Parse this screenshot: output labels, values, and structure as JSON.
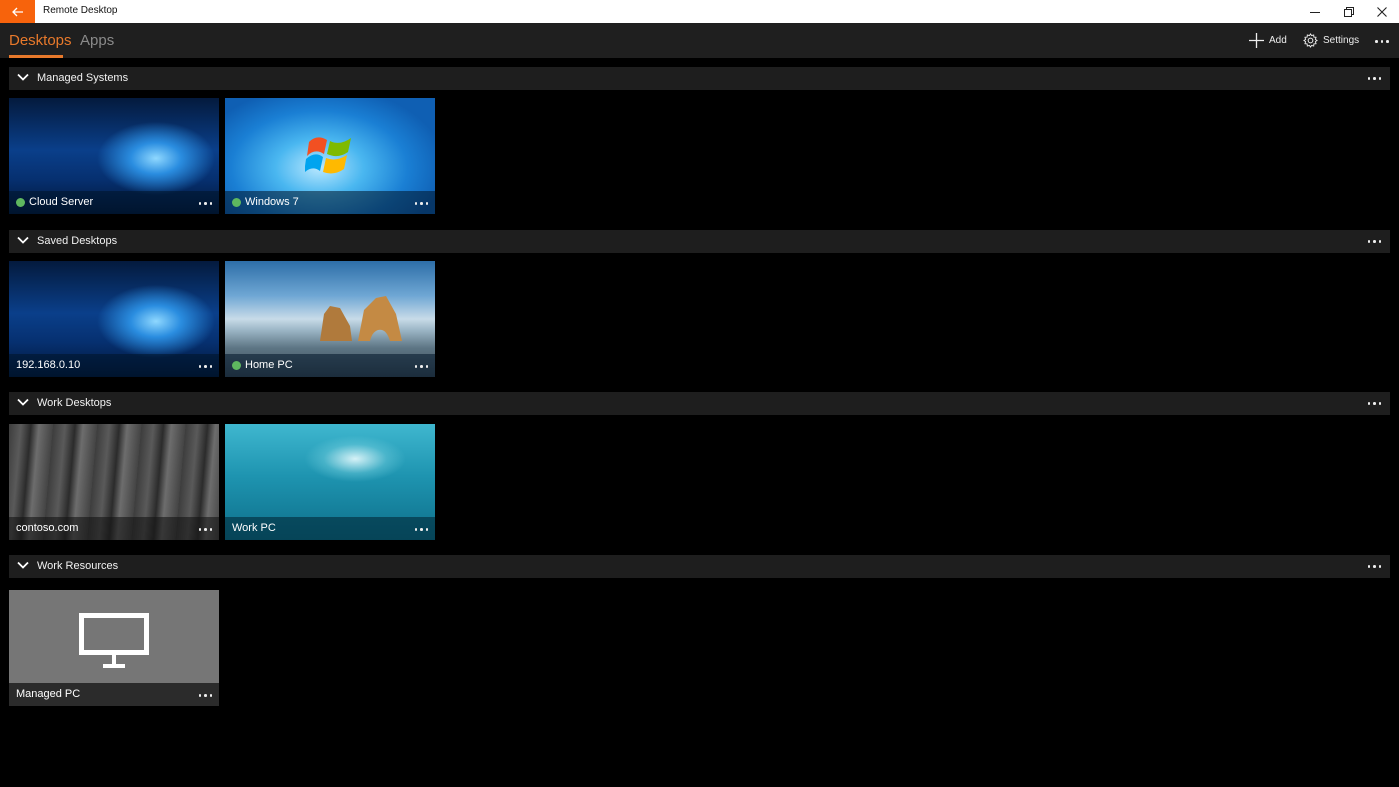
{
  "window": {
    "title": "Remote Desktop",
    "accent_color": "#f7630c",
    "controls": [
      "minimize",
      "restore",
      "close"
    ]
  },
  "appbar": {
    "tabs": [
      {
        "label": "Desktops",
        "active": true
      },
      {
        "label": "Apps",
        "active": false
      }
    ],
    "commands": {
      "add_label": "Add",
      "settings_label": "Settings"
    },
    "tab_accent_color": "#e8792b"
  },
  "status_color": "#5fb85f",
  "sections": [
    {
      "title": "Managed Systems",
      "tiles": [
        {
          "name": "Cloud Server",
          "status": "online",
          "wallpaper": "windows-10"
        },
        {
          "name": "Windows 7",
          "status": "online",
          "wallpaper": "windows-7"
        }
      ]
    },
    {
      "title": "Saved Desktops",
      "tiles": [
        {
          "name": "192.168.0.10",
          "status": "none",
          "wallpaper": "windows-10"
        },
        {
          "name": "Home PC",
          "status": "online",
          "wallpaper": "beach"
        }
      ]
    },
    {
      "title": "Work Desktops",
      "tiles": [
        {
          "name": "contoso.com",
          "status": "none",
          "wallpaper": "rock-cliff"
        },
        {
          "name": "Work PC",
          "status": "none",
          "wallpaper": "underwater"
        }
      ]
    },
    {
      "title": "Work Resources",
      "tiles": [
        {
          "name": "Managed PC",
          "status": "none",
          "wallpaper": "monitor-placeholder"
        }
      ]
    }
  ]
}
